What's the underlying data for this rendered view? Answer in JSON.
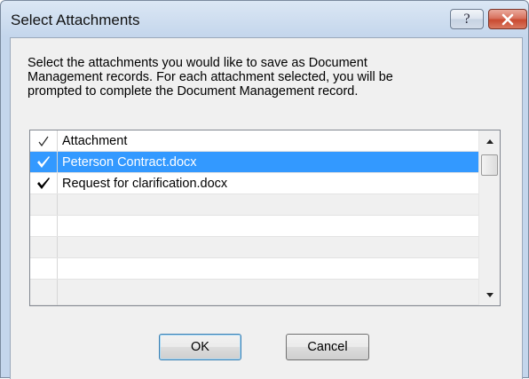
{
  "window": {
    "title": "Select Attachments",
    "help_label": "?",
    "close_label": "×"
  },
  "instructions": [
    "Select the attachments you would like to save as Document",
    "Management records. For each attachment selected, you will be",
    "prompted to complete the Document Management record."
  ],
  "list": {
    "header": {
      "check_icon": "check-icon",
      "label": "Attachment"
    },
    "items": [
      {
        "label": "Peterson Contract.docx",
        "checked": true,
        "selected": true
      },
      {
        "label": "Request for clarification.docx",
        "checked": true,
        "selected": false
      }
    ],
    "empty_rows": 5
  },
  "buttons": {
    "ok": "OK",
    "cancel": "Cancel"
  },
  "colors": {
    "selection": "#3399ff",
    "titlebar": "#c4d6ec",
    "close": "#c94a30"
  }
}
